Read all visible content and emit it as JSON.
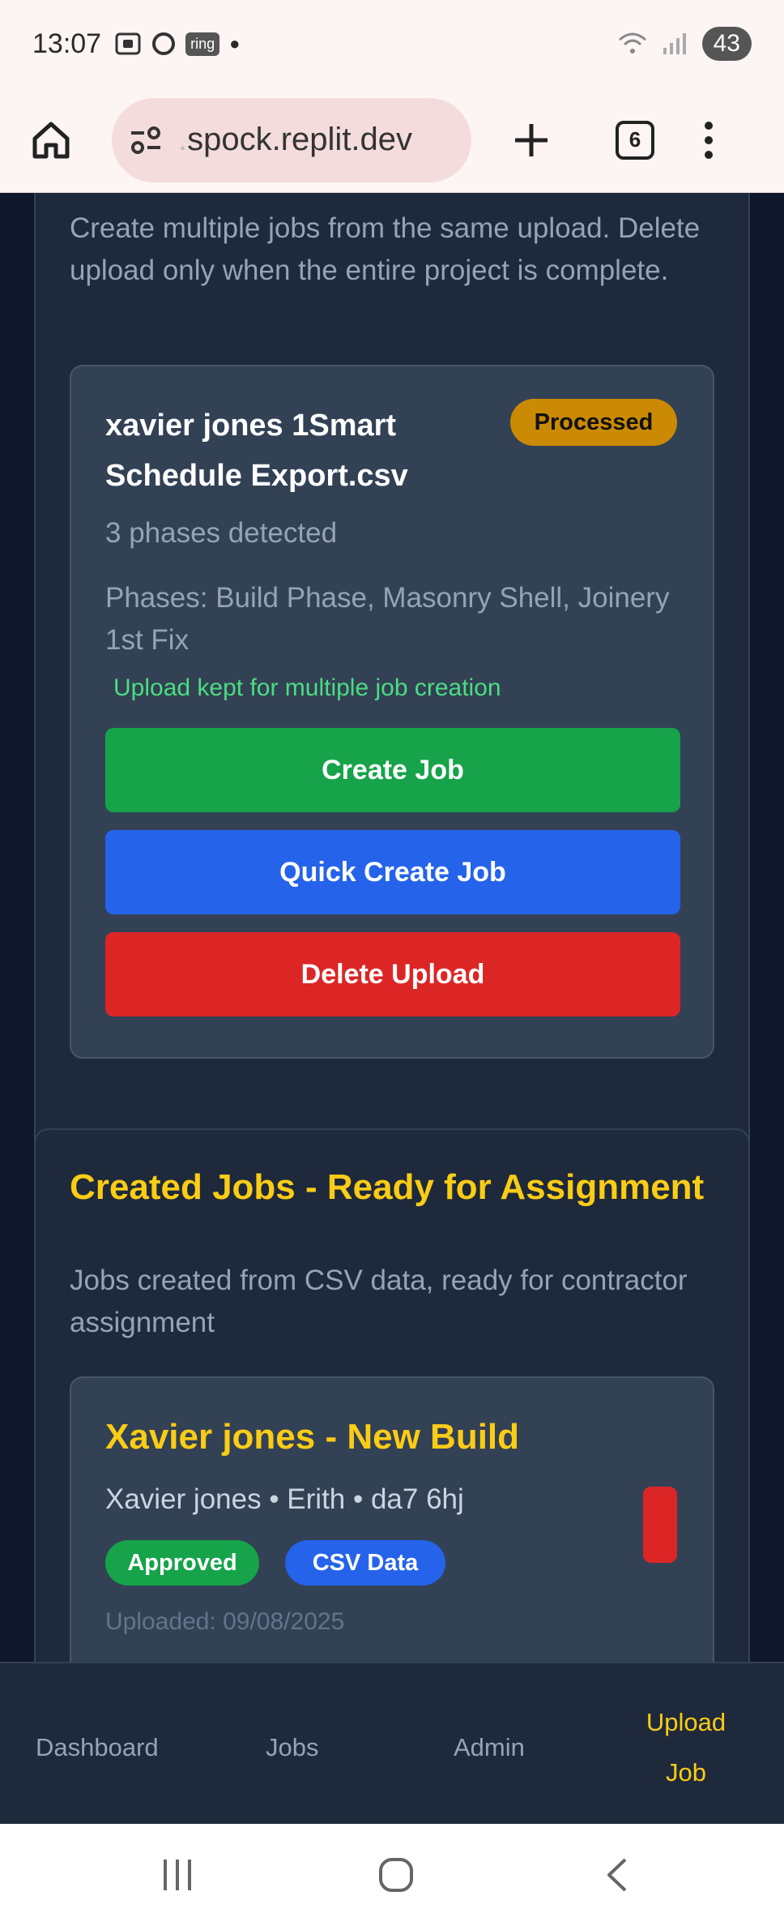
{
  "status_bar": {
    "time": "13:07",
    "ring_label": "ring",
    "battery": "43",
    "wifi_label": "5"
  },
  "browser": {
    "url_prefix": ".",
    "url": "spock.replit.dev",
    "tab_count": "6"
  },
  "upload_section": {
    "description": "Create multiple jobs from the same upload. Delete upload only when the entire project is complete.",
    "card": {
      "file_name": "xavier jones 1Smart Schedule Export.csv",
      "status_badge": "Processed",
      "phases_count": "3 phases detected",
      "phases_list": "Phases: Build Phase, Masonry Shell, Joinery 1st Fix",
      "kept_note": "Upload kept for multiple job creation",
      "create_job_label": "Create Job",
      "quick_create_label": "Quick Create Job",
      "delete_label": "Delete Upload"
    }
  },
  "jobs_section": {
    "title": "Created Jobs - Ready for Assignment",
    "description": "Jobs created from CSV data, ready for contractor assignment",
    "job": {
      "title": "Xavier jones - New Build",
      "meta": "Xavier jones • Erith • da7 6hj",
      "status_pill": "Approved",
      "source_pill": "CSV Data",
      "uploaded": "Uploaded: 09/08/2025"
    }
  },
  "app_nav": {
    "dashboard": "Dashboard",
    "jobs": "Jobs",
    "admin": "Admin",
    "upload_job": "Upload Job",
    "active": "upload_job"
  },
  "colors": {
    "accent_yellow": "#facc15",
    "green": "#16a34a",
    "blue": "#2563eb",
    "red": "#dc2626",
    "processed_badge": "#ca8a04",
    "background": "#0f172a",
    "card": "#334155"
  },
  "icons": {
    "home": "home-icon",
    "site_settings": "tune-icon",
    "new_tab": "plus-icon",
    "overflow": "more-vert-icon",
    "recents": "recents-icon",
    "system_home": "circle-home-icon",
    "back": "back-chevron-icon"
  }
}
